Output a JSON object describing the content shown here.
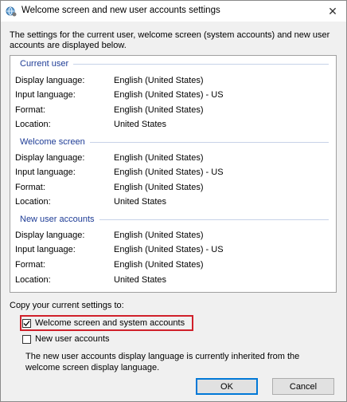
{
  "window": {
    "title": "Welcome screen and new user accounts settings",
    "icon": "globe-settings-icon",
    "close_glyph": "✕"
  },
  "intro": "The settings for the current user, welcome screen (system accounts) and new user accounts are displayed below.",
  "groups": [
    {
      "header": "Current user",
      "rows": [
        {
          "label": "Display language:",
          "value": "English (United States)"
        },
        {
          "label": "Input language:",
          "value": "English (United States) - US"
        },
        {
          "label": "Format:",
          "value": "English (United States)"
        },
        {
          "label": "Location:",
          "value": "United States"
        }
      ]
    },
    {
      "header": "Welcome screen",
      "rows": [
        {
          "label": "Display language:",
          "value": "English (United States)"
        },
        {
          "label": "Input language:",
          "value": "English (United States) - US"
        },
        {
          "label": "Format:",
          "value": "English (United States)"
        },
        {
          "label": "Location:",
          "value": "United States"
        }
      ]
    },
    {
      "header": "New user accounts",
      "rows": [
        {
          "label": "Display language:",
          "value": "English (United States)"
        },
        {
          "label": "Input language:",
          "value": "English (United States) - US"
        },
        {
          "label": "Format:",
          "value": "English (United States)"
        },
        {
          "label": "Location:",
          "value": "United States"
        }
      ]
    }
  ],
  "copy": {
    "label": "Copy your current settings to:",
    "welcome_checkbox": {
      "label": "Welcome screen and system accounts",
      "checked": true
    },
    "new_user_checkbox": {
      "label": "New user accounts",
      "checked": false
    },
    "note": "The new user accounts display language is currently inherited from the welcome screen display language."
  },
  "buttons": {
    "ok": "OK",
    "cancel": "Cancel"
  },
  "colors": {
    "group_header": "#1e3c96",
    "highlight": "#d0202a",
    "default_button_border": "#0078d7"
  }
}
